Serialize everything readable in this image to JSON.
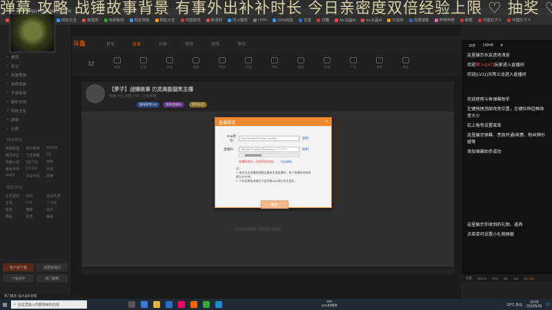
{
  "browser": {
    "url": "https://www.douyu.com/",
    "bookmarks": [
      "天猫精选",
      "吉祥游戏",
      "网址大全",
      "淘宝网",
      "电商新闻",
      "网址导航",
      "网址大全",
      "中国资讯",
      "新浪网",
      "同上服务",
      "Links",
      "2345网址",
      "百度",
      "优酷",
      "Mc冰晶M",
      "mc冰晶M",
      "分享网",
      "百度搜索",
      "哔哩哔哩",
      "新聞",
      "中国孔子人",
      "中国孔子人"
    ]
  },
  "overlay": {
    "marquee": "弹幕 攻略 战锤故事背景 有事外出补补时长 今日亲密度双倍经验上限 ♡ 抽奖 ♡ 加"
  },
  "site": {
    "logo": "斗鱼",
    "topnav": [
      "首页",
      "直播",
      "分类",
      "视频",
      "游戏",
      "鱼吧"
    ],
    "categories": [
      "12",
      "关注",
      "历史",
      "竞技",
      "推荐",
      "网游",
      "手游",
      "单机",
      "娱乐",
      "科技",
      "户外",
      "体育",
      "更多"
    ]
  },
  "sidebar": {
    "items": [
      "推荐",
      "关注",
      "网游竞技",
      "单机热游",
      "手游休闲",
      "娱乐天地",
      "科技文化",
      "颜值",
      "分类"
    ],
    "grid_a": [
      "英雄联盟",
      "和平精英",
      "DOTA2",
      "绝地求生",
      "王者荣耀",
      "CF",
      "穿越火线",
      "QQ飞车",
      "DNF",
      "魔兽世界",
      "CS:GO",
      "炉石",
      "APEX",
      "永劫无间",
      "原神"
    ],
    "grid_b": [
      "主机游戏",
      "单机",
      "综合手游",
      "主机",
      "户外",
      "二次元",
      "颜值",
      "舞蹈",
      "音乐",
      "数码",
      "科技",
      "美食"
    ],
    "head_a": "网游竞技",
    "head_b": "娱乐天地",
    "footer": [
      "客户端下载",
      "创建直播间",
      "下载APP",
      "热门推荐"
    ]
  },
  "stream": {
    "title": "【萝子】战锤故事 刃灵高能猫笑主播",
    "sub": "直播  分区  举报  分享  · 王者荣耀",
    "tags": [
      "猫咪厨师 lv9",
      "猫咪直播间",
      "我的标签"
    ]
  },
  "modal": {
    "title": "直播推流",
    "close": "×",
    "rtmp_label": "rtmp地址：",
    "rtmp_value": "rtmp://sendtc3a.douyu.com/live",
    "key_label": "直播码：",
    "key_value": "284555rrSTg5zhYiPne5ecret=***********",
    "copy": "复制",
    "warn": "直播码将在一段时间后失效，",
    "refresh": "点击刷新",
    "notes": "注：\n1. 每次点击直播按钮都会重新生成直播码，每个直播码的有效期为30分钟。\n2. 只有切换推流端后才会导致rtmp地址发生变化。",
    "confirm": "确定"
  },
  "video": {
    "caption": "欢迎来到直播间 · 刷新或点击播放"
  },
  "chat": {
    "top": [
      "16件",
      "149/48",
      "★"
    ],
    "messages": [
      {
        "text": "这里展示水友进场消息"
      },
      {
        "text": "欢迎",
        "red": "萝卜(LV7)",
        "tail": "玩家进入直播间"
      },
      {
        "text": "欢迎(LV11)天降义龙进入直播间"
      },
      {
        "text": "欢迎使用斗鱼弹幕助手"
      },
      {
        "text": "左键拖拽顶部改变位置，左键拉伸边框改变大小"
      },
      {
        "text": "右上角有设置菜单"
      },
      {
        "text": "这里展示弹幕、贵族开通/续费、粉丝牌升级等"
      },
      {
        "text": "添加弹幕助手成功"
      },
      {
        "text": "这里展示你收到的礼物、道具"
      },
      {
        "text": "点菜单可设置小礼物屏蔽"
      }
    ],
    "bottom": [
      "设置",
      "DRL%",
      "RTS",
      "BG",
      "DLI",
      "DV 101"
    ]
  },
  "status": {
    "text": "热门播放: 猫大美好留家"
  },
  "taskbar": {
    "search_placeholder": "在这里输入你要搜索的内容",
    "weather": "29°C 多云",
    "time": "15:09",
    "date": "2022/6/29",
    "cpu": "39%",
    "cpu_label": "CPU利用率"
  }
}
